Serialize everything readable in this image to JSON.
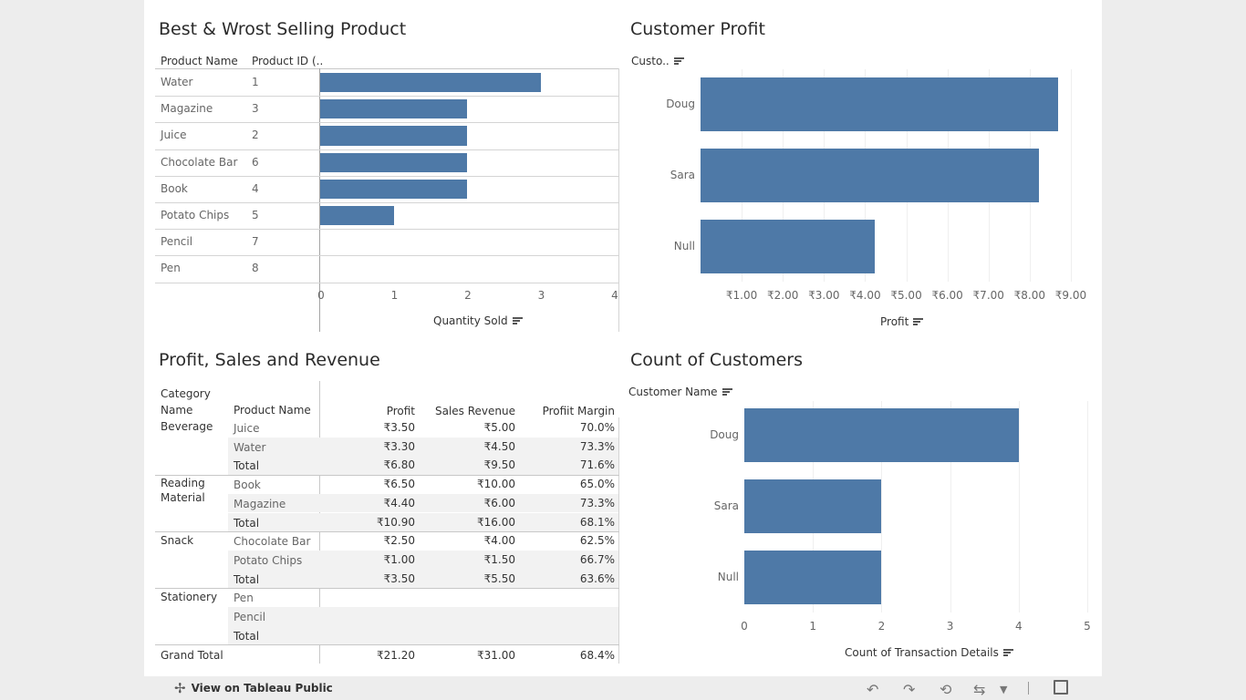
{
  "best_worst": {
    "title": "Best & Wrost Selling  Product",
    "col_product": "Product Name",
    "col_id": "Product ID (..",
    "rows": [
      {
        "name": "Water",
        "id": "1"
      },
      {
        "name": "Magazine",
        "id": "3"
      },
      {
        "name": "Juice",
        "id": "2"
      },
      {
        "name": "Chocolate Bar",
        "id": "6"
      },
      {
        "name": "Book",
        "id": "4"
      },
      {
        "name": "Potato Chips",
        "id": "5"
      },
      {
        "name": "Pencil",
        "id": "7"
      },
      {
        "name": "Pen",
        "id": "8"
      }
    ],
    "xticks": [
      "0",
      "1",
      "2",
      "3",
      "4"
    ],
    "xlabel": "Quantity Sold"
  },
  "customer_profit": {
    "title": "Customer Profit",
    "col_header": "Custo..",
    "categories": [
      "Doug",
      "Sara",
      "Null"
    ],
    "xticks": [
      "₹1.00",
      "₹2.00",
      "₹3.00",
      "₹4.00",
      "₹5.00",
      "₹6.00",
      "₹7.00",
      "₹8.00",
      "₹9.00"
    ],
    "xlabel": "Profit"
  },
  "psr": {
    "title": "Profit, Sales and Revenue",
    "col_category_1": "Category",
    "col_category_2": "Name",
    "col_product": "Product Name",
    "col_profit": "Profit",
    "col_sales": "Sales Revenue",
    "col_margin": "Profiit Margin",
    "cat_beverage": "Beverage",
    "cat_reading_1": "Reading",
    "cat_reading_2": "Material",
    "cat_snack": "Snack",
    "cat_stationery": "Stationery",
    "rows": [
      {
        "product": "Juice",
        "profit": "₹3.50",
        "sales": "₹5.00",
        "margin": "70.0%"
      },
      {
        "product": "Water",
        "profit": "₹3.30",
        "sales": "₹4.50",
        "margin": "73.3%"
      },
      {
        "product": "Total",
        "profit": "₹6.80",
        "sales": "₹9.50",
        "margin": "71.6%"
      },
      {
        "product": "Book",
        "profit": "₹6.50",
        "sales": "₹10.00",
        "margin": "65.0%"
      },
      {
        "product": "Magazine",
        "profit": "₹4.40",
        "sales": "₹6.00",
        "margin": "73.3%"
      },
      {
        "product": "Total",
        "profit": "₹10.90",
        "sales": "₹16.00",
        "margin": "68.1%"
      },
      {
        "product": "Chocolate Bar",
        "profit": "₹2.50",
        "sales": "₹4.00",
        "margin": "62.5%"
      },
      {
        "product": "Potato Chips",
        "profit": "₹1.00",
        "sales": "₹1.50",
        "margin": "66.7%"
      },
      {
        "product": "Total",
        "profit": "₹3.50",
        "sales": "₹5.50",
        "margin": "63.6%"
      },
      {
        "product": "Pen",
        "profit": "",
        "sales": "",
        "margin": ""
      },
      {
        "product": "Pencil",
        "profit": "",
        "sales": "",
        "margin": ""
      },
      {
        "product": "Total",
        "profit": "",
        "sales": "",
        "margin": ""
      }
    ],
    "grand_total_label": "Grand Total",
    "grand_total": {
      "profit": "₹21.20",
      "sales": "₹31.00",
      "margin": "68.4%"
    }
  },
  "count_customers": {
    "title": "Count of Customers",
    "col_header": "Customer Name",
    "categories": [
      "Doug",
      "Sara",
      "Null"
    ],
    "xticks": [
      "0",
      "1",
      "2",
      "3",
      "4",
      "5"
    ],
    "xlabel": "Count of Transaction Details"
  },
  "footer": {
    "view_label": "View on Tableau Public"
  },
  "colors": {
    "bar": "#4e79a7"
  },
  "chart_data": [
    {
      "type": "bar",
      "title": "Best & Wrost Selling  Product",
      "categories": [
        "Water",
        "Magazine",
        "Juice",
        "Chocolate Bar",
        "Book",
        "Potato Chips",
        "Pencil",
        "Pen"
      ],
      "values": [
        3,
        2,
        2,
        2,
        2,
        1,
        0,
        0
      ],
      "xlabel": "Quantity Sold",
      "xlim": [
        0,
        4
      ],
      "orientation": "horizontal"
    },
    {
      "type": "bar",
      "title": "Customer Profit",
      "categories": [
        "Doug",
        "Sara",
        "Null"
      ],
      "values": [
        8.7,
        8.23,
        4.23
      ],
      "xlabel": "Profit",
      "xlim": [
        0,
        9.4
      ],
      "orientation": "horizontal"
    },
    {
      "type": "bar",
      "title": "Count of Customers",
      "categories": [
        "Doug",
        "Sara",
        "Null"
      ],
      "values": [
        4,
        2,
        2
      ],
      "xlabel": "Count of Transaction Details",
      "xlim": [
        0,
        5
      ],
      "orientation": "horizontal"
    }
  ]
}
